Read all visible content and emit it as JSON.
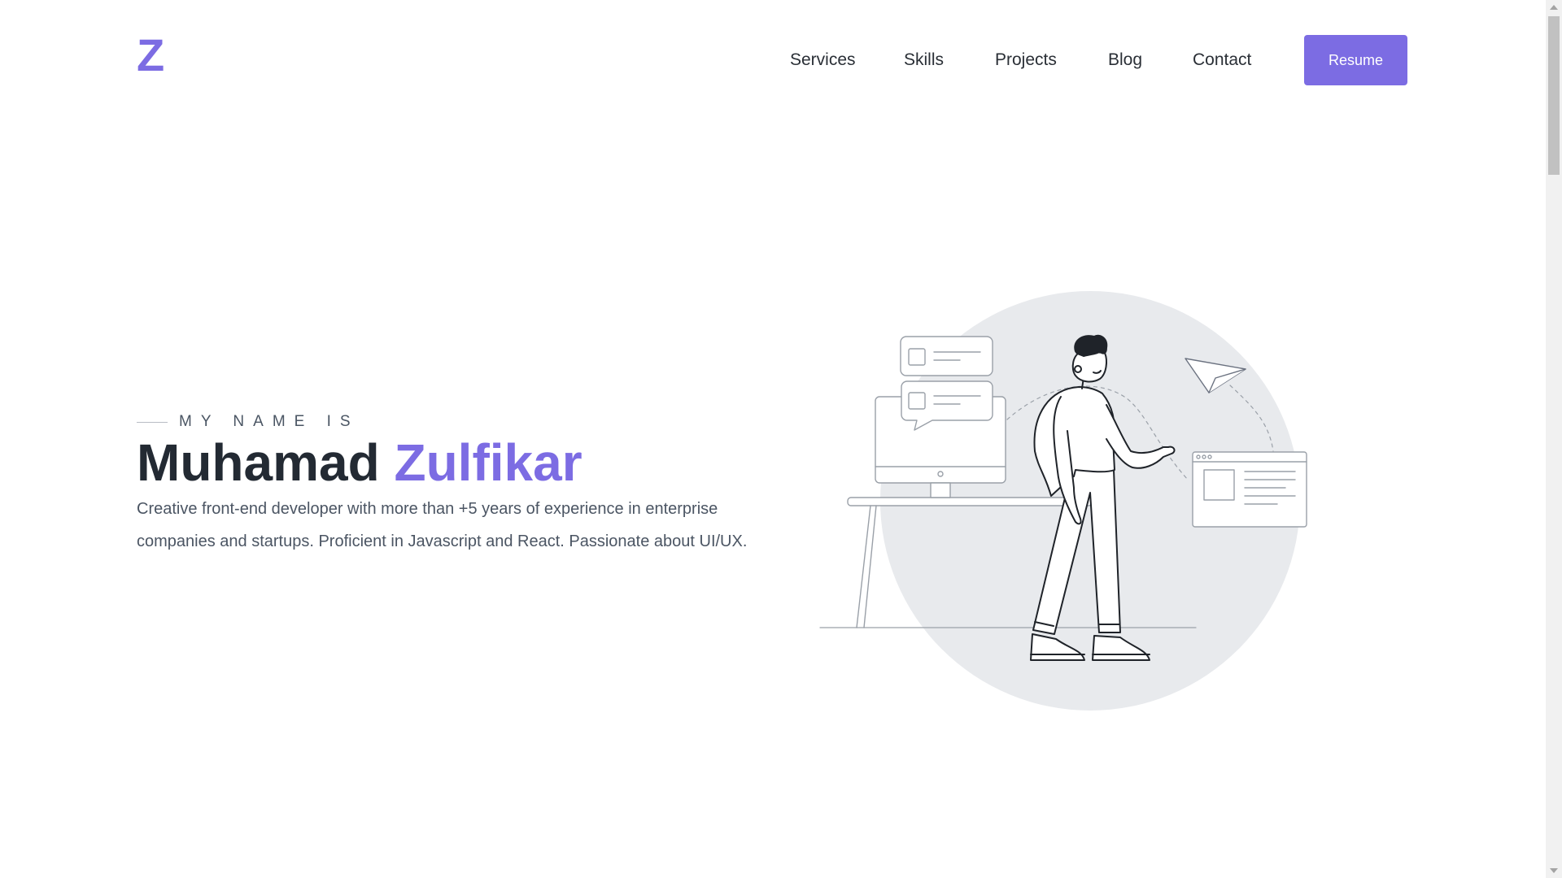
{
  "header": {
    "logo": "Z",
    "nav": [
      {
        "label": "Services"
      },
      {
        "label": "Skills"
      },
      {
        "label": "Projects"
      },
      {
        "label": "Blog"
      },
      {
        "label": "Contact"
      }
    ],
    "resume_label": "Resume"
  },
  "hero": {
    "eyebrow": "MY NAME IS",
    "first_name": "Muhamad",
    "last_name": "Zulfikar",
    "description": "Creative front-end developer with more than +5 years of experience in enterprise companies and startups. Proficient in Javascript and React. Passionate about UI/UX."
  },
  "colors": {
    "accent": "#7c6ce3",
    "text_dark": "#232a33",
    "text_body": "#4b5563",
    "illustration_circle": "#e8eaed"
  }
}
